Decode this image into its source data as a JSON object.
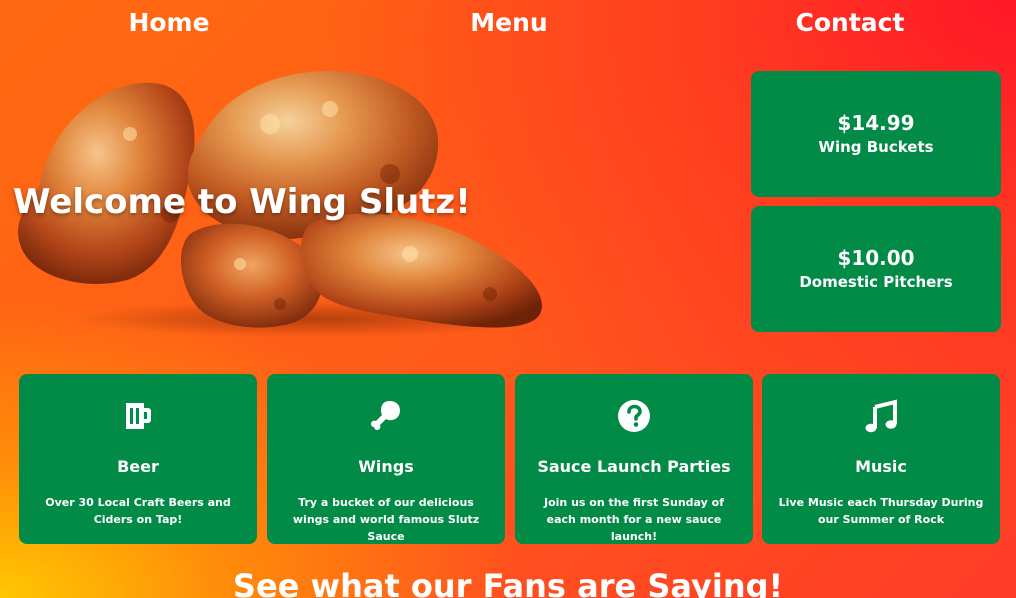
{
  "nav": {
    "home": "Home",
    "menu": "Menu",
    "contact": "Contact"
  },
  "hero": {
    "title": "Welcome to Wing Slutz!",
    "image_icon": "chicken-wings-photo"
  },
  "specials": [
    {
      "price": "$14.99",
      "label": "Wing Buckets"
    },
    {
      "price": "$10.00",
      "label": "Domestic Pitchers"
    }
  ],
  "features": [
    {
      "icon": "beer-mug-icon",
      "title": "Beer",
      "desc": "Over 30 Local Craft Beers and Ciders on Tap!"
    },
    {
      "icon": "drumstick-icon",
      "title": "Wings",
      "desc": "Try a bucket of our delicious wings and world famous Slutz Sauce"
    },
    {
      "icon": "question-circle-icon",
      "title": "Sauce Launch Parties",
      "desc": "Join us on the first Sunday of each month for a new sauce launch!"
    },
    {
      "icon": "music-note-icon",
      "title": "Music",
      "desc": "Live Music each Thursday During our Summer of Rock"
    }
  ],
  "fans": {
    "heading": "See what our Fans are Saying!"
  },
  "colors": {
    "card_green": "#028a47",
    "background_orange": "#ff6a10",
    "background_red": "#ff2a2a",
    "background_yellow": "#ffcc00",
    "text": "#ffffff"
  }
}
